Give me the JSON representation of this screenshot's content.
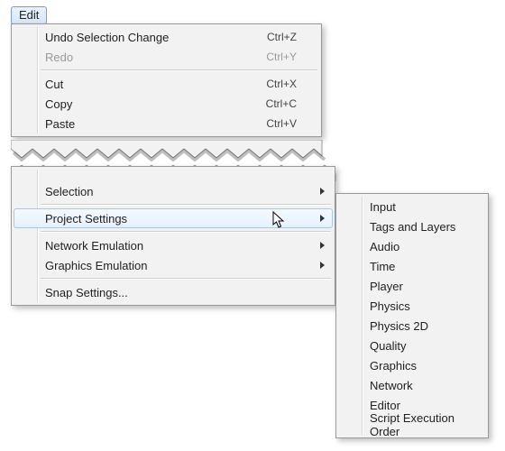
{
  "edit_button_label": "Edit",
  "top_menu": {
    "items": [
      {
        "label": "Undo Selection Change",
        "shortcut": "Ctrl+Z",
        "disabled": false
      },
      {
        "label": "Redo",
        "shortcut": "Ctrl+Y",
        "disabled": true
      }
    ],
    "items2": [
      {
        "label": "Cut",
        "shortcut": "Ctrl+X"
      },
      {
        "label": "Copy",
        "shortcut": "Ctrl+C"
      },
      {
        "label": "Paste",
        "shortcut": "Ctrl+V"
      }
    ]
  },
  "bottom_menu": {
    "items_a": [
      {
        "label": "Selection",
        "submenu": true
      }
    ],
    "items_b": [
      {
        "label": "Project Settings",
        "submenu": true,
        "highlight": true
      }
    ],
    "items_c": [
      {
        "label": "Network Emulation",
        "submenu": true
      },
      {
        "label": "Graphics Emulation",
        "submenu": true
      }
    ],
    "items_d": [
      {
        "label": "Snap Settings..."
      }
    ]
  },
  "submenu": {
    "items": [
      "Input",
      "Tags and Layers",
      "Audio",
      "Time",
      "Player",
      "Physics",
      "Physics 2D",
      "Quality",
      "Graphics",
      "Network",
      "Editor",
      "Script Execution Order"
    ]
  }
}
